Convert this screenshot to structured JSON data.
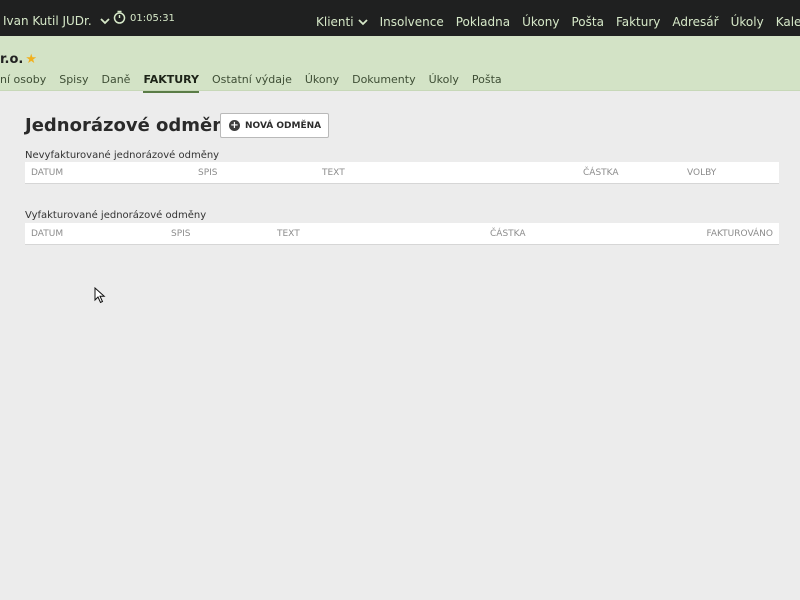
{
  "topbar": {
    "user_name": "Ivan Kutil JUDr.",
    "timer": "01:05:31",
    "menu": [
      "Klienti",
      "Insolvence",
      "Pokladna",
      "Úkony",
      "Pošta",
      "Faktury",
      "Adresář",
      "Úkoly",
      "Kalendá"
    ]
  },
  "subheader": {
    "company": "r.o.",
    "tabs": [
      "ní osoby",
      "Spisy",
      "Daně",
      "FAKTURY",
      "Ostatní výdaje",
      "Úkony",
      "Dokumenty",
      "Úkoly",
      "Pošta"
    ],
    "active_tab": "FAKTURY"
  },
  "main": {
    "title": "Jednorázové odměny",
    "new_button": "NOVÁ ODMĚNA",
    "unbilled": {
      "label": "Nevyfakturované jednorázové odměny",
      "columns": [
        "DATUM",
        "SPIS",
        "TEXT",
        "ČÁSTKA",
        "VOLBY"
      ]
    },
    "billed": {
      "label": "Vyfakturované jednorázové odměny",
      "columns": [
        "DATUM",
        "SPIS",
        "TEXT",
        "ČÁSTKA",
        "FAKTUROVÁNO"
      ]
    }
  },
  "colors": {
    "topbar": "#1f2020",
    "subheader": "#d3e3c6",
    "background": "#ececec",
    "accent": "#5a7c46"
  }
}
